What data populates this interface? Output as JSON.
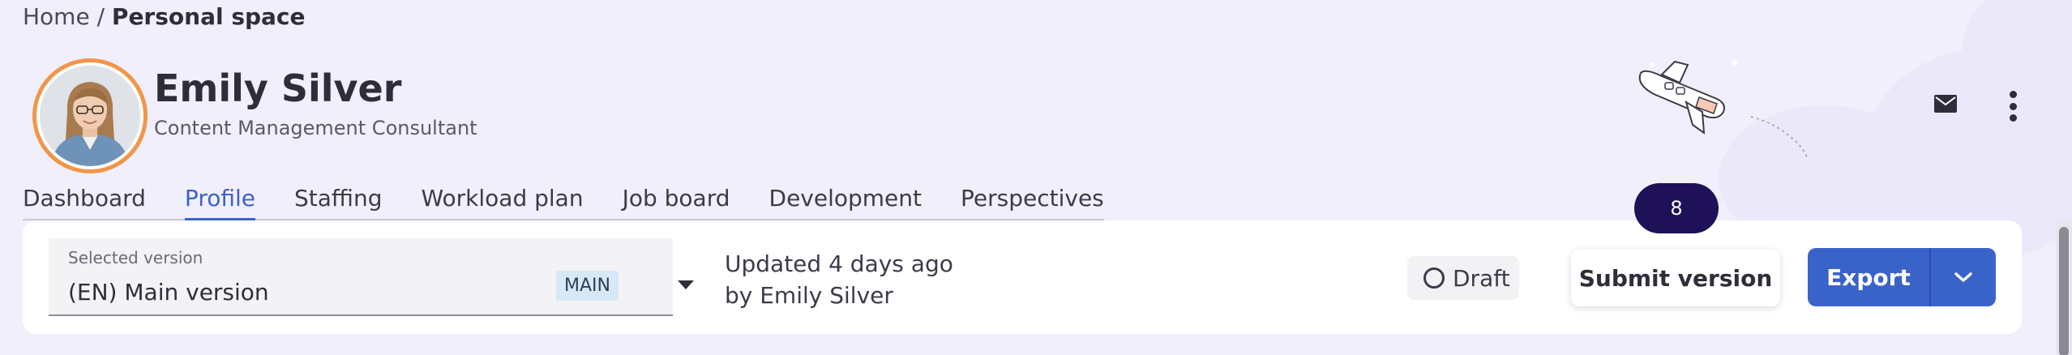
{
  "breadcrumb": {
    "home": "Home",
    "separator": " / ",
    "current": "Personal space"
  },
  "profile": {
    "name": "Emily Silver",
    "title": "Content Management Consultant"
  },
  "icons": {
    "mail": "mail-icon",
    "more": "more-vertical-icon",
    "rocket": "rocket-illustration"
  },
  "tabs": [
    {
      "label": "Dashboard"
    },
    {
      "label": "Profile"
    },
    {
      "label": "Staffing"
    },
    {
      "label": "Workload plan"
    },
    {
      "label": "Job board"
    },
    {
      "label": "Development"
    },
    {
      "label": "Perspectives"
    }
  ],
  "active_tab": "Profile",
  "version": {
    "label": "Selected version",
    "value": "(EN) Main version",
    "tag": "MAIN"
  },
  "updated": {
    "line1": "Updated 4 days ago",
    "line2": "by Emily Silver"
  },
  "status": {
    "label": "Draft"
  },
  "notification_count": "8",
  "actions": {
    "submit": "Submit version",
    "export": "Export"
  },
  "colors": {
    "accent": "#3a63c9",
    "avatar_ring": "#f0964a",
    "badge": "#1f1158",
    "background": "#f1effc"
  }
}
